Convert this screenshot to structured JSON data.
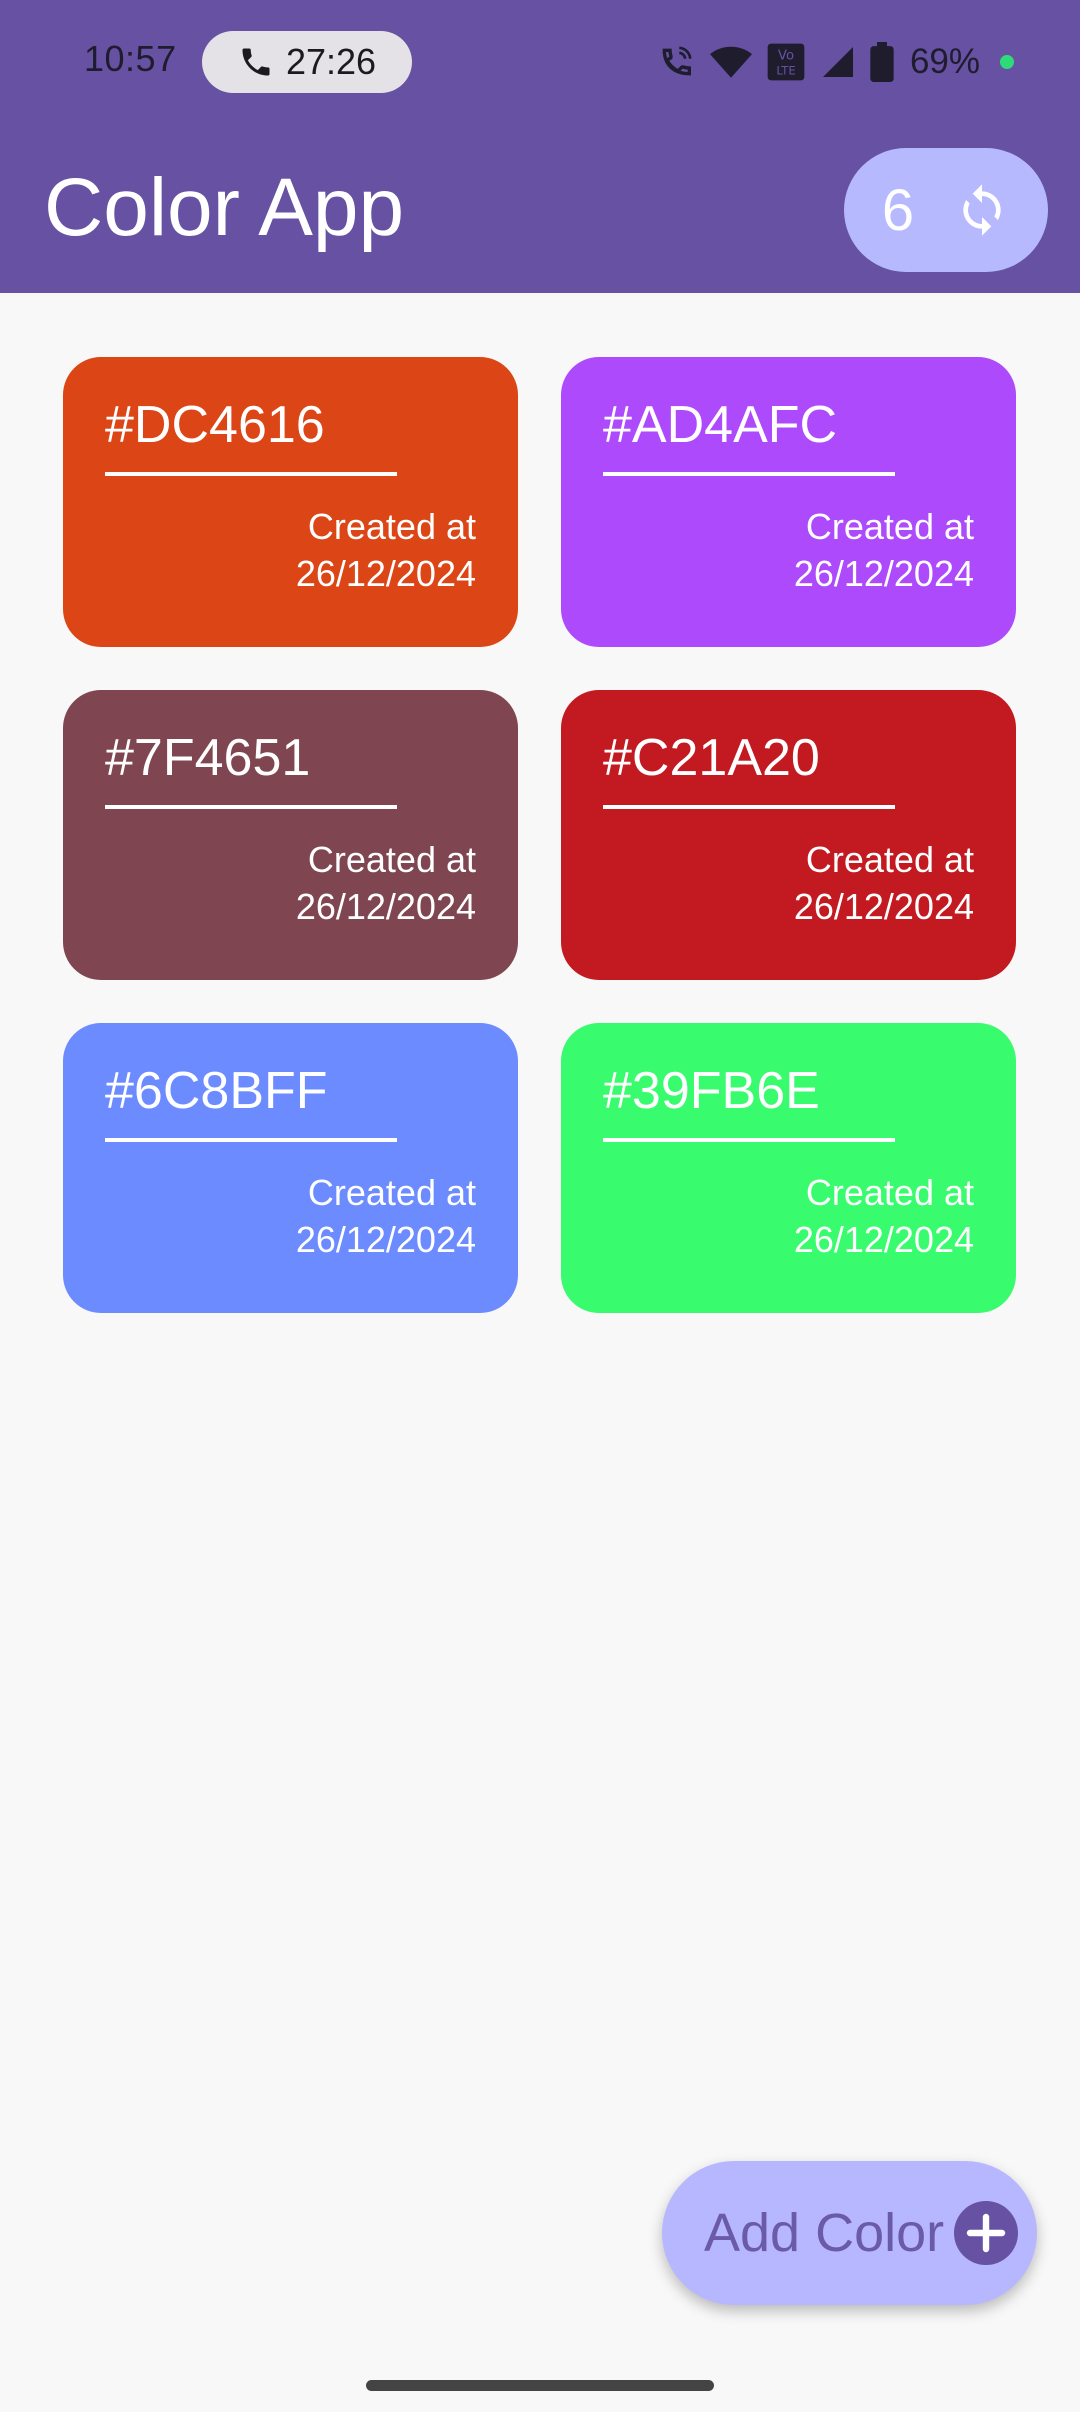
{
  "status_bar": {
    "time": "10:57",
    "call_duration": "27:26",
    "battery_percent": "69%",
    "icons": [
      "phone-icon",
      "wifi-call-icon",
      "wifi-icon",
      "volte-icon",
      "signal-icon",
      "battery-icon",
      "privacy-dot-icon"
    ]
  },
  "header": {
    "title": "Color App",
    "count": "6",
    "sync_icon": "sync-icon",
    "color": "#6651A3"
  },
  "colors": [
    {
      "hex": "#DC4616",
      "created_label": "Created at",
      "date": "26/12/2024"
    },
    {
      "hex": "#AD4AFC",
      "created_label": "Created at",
      "date": "26/12/2024"
    },
    {
      "hex": "#7F4651",
      "created_label": "Created at",
      "date": "26/12/2024"
    },
    {
      "hex": "#C21A20",
      "created_label": "Created at",
      "date": "26/12/2024"
    },
    {
      "hex": "#6C8BFF",
      "created_label": "Created at",
      "date": "26/12/2024"
    },
    {
      "hex": "#39FB6E",
      "created_label": "Created at",
      "date": "26/12/2024"
    }
  ],
  "fab": {
    "label": "Add Color",
    "icon": "add-circle-icon",
    "color": "#B6B7FE"
  }
}
